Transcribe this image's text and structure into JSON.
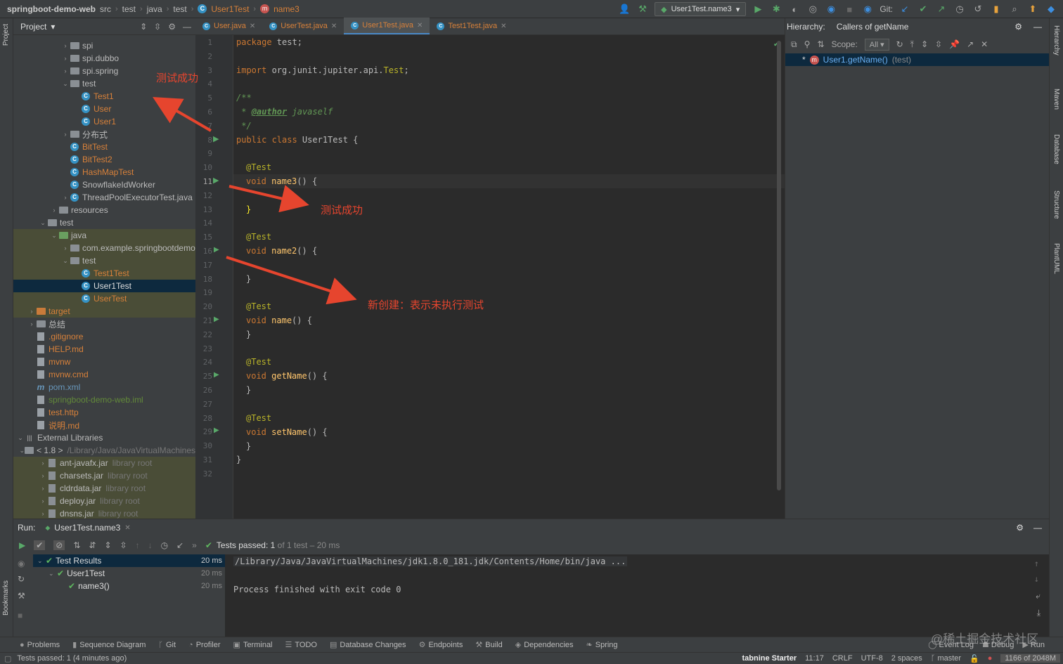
{
  "navbar": {
    "project": "springboot-demo-web",
    "crumbs": [
      "src",
      "test",
      "java",
      "test"
    ],
    "file": "User1Test",
    "method": "name3",
    "run_config": "User1Test.name3",
    "git_label": "Git:"
  },
  "project_panel": {
    "title": "Project",
    "items": [
      {
        "label": "spi",
        "indent": 4,
        "kind": "folder",
        "arrow": "›"
      },
      {
        "label": "spi.dubbo",
        "indent": 4,
        "kind": "folder",
        "arrow": "›"
      },
      {
        "label": "spi.spring",
        "indent": 4,
        "kind": "folder",
        "arrow": "›"
      },
      {
        "label": "test",
        "indent": 4,
        "kind": "folder",
        "arrow": "⌄"
      },
      {
        "label": "Test1",
        "indent": 5,
        "kind": "class",
        "color": "orange"
      },
      {
        "label": "User",
        "indent": 5,
        "kind": "class",
        "color": "orange"
      },
      {
        "label": "User1",
        "indent": 5,
        "kind": "class",
        "color": "orange"
      },
      {
        "label": "分布式",
        "indent": 4,
        "kind": "folder",
        "arrow": "›"
      },
      {
        "label": "BitTest",
        "indent": 4,
        "kind": "class",
        "color": "orange"
      },
      {
        "label": "BitTest2",
        "indent": 4,
        "kind": "class",
        "color": "orange"
      },
      {
        "label": "HashMapTest",
        "indent": 4,
        "kind": "class",
        "color": "orange"
      },
      {
        "label": "SnowflakeIdWorker",
        "indent": 4,
        "kind": "class",
        "color": "plain"
      },
      {
        "label": "ThreadPoolExecutorTest.java",
        "indent": 4,
        "kind": "class",
        "color": "plain",
        "arrow": "›"
      },
      {
        "label": "resources",
        "indent": 3,
        "kind": "folder",
        "arrow": "›"
      },
      {
        "label": "test",
        "indent": 2,
        "kind": "folder",
        "arrow": "⌄"
      },
      {
        "label": "java",
        "indent": 3,
        "kind": "folder-green",
        "arrow": "⌄",
        "hl": "olive"
      },
      {
        "label": "com.example.springbootdemo",
        "indent": 4,
        "kind": "folder",
        "arrow": "›",
        "hl": "olive"
      },
      {
        "label": "test",
        "indent": 4,
        "kind": "folder",
        "arrow": "⌄",
        "hl": "olive"
      },
      {
        "label": "Test1Test",
        "indent": 5,
        "kind": "class",
        "color": "orange",
        "hl": "olive"
      },
      {
        "label": "User1Test",
        "indent": 5,
        "kind": "class",
        "color": "plain",
        "hl": "sel"
      },
      {
        "label": "UserTest",
        "indent": 5,
        "kind": "class",
        "color": "orange",
        "hl": "olive"
      },
      {
        "label": "target",
        "indent": 1,
        "kind": "folder-orange",
        "arrow": "›",
        "color": "orange",
        "hl": "olive"
      },
      {
        "label": "总结",
        "indent": 1,
        "kind": "folder",
        "arrow": "›"
      },
      {
        "label": ".gitignore",
        "indent": 1,
        "kind": "file",
        "color": "orange"
      },
      {
        "label": "HELP.md",
        "indent": 1,
        "kind": "file",
        "color": "orange"
      },
      {
        "label": "mvnw",
        "indent": 1,
        "kind": "file",
        "color": "orange"
      },
      {
        "label": "mvnw.cmd",
        "indent": 1,
        "kind": "file",
        "color": "orange"
      },
      {
        "label": "pom.xml",
        "indent": 1,
        "kind": "maven",
        "color": "blue"
      },
      {
        "label": "springboot-demo-web.iml",
        "indent": 1,
        "kind": "file",
        "color": "green"
      },
      {
        "label": "test.http",
        "indent": 1,
        "kind": "file",
        "color": "orange"
      },
      {
        "label": "说明.md",
        "indent": 1,
        "kind": "file",
        "color": "orange"
      },
      {
        "label": "External Libraries",
        "indent": 0,
        "kind": "lib",
        "arrow": "⌄"
      },
      {
        "label": "< 1.8 >",
        "indent": 1,
        "kind": "folder",
        "arrow": "⌄",
        "suffix": "/Library/Java/JavaVirtualMachines"
      },
      {
        "label": "ant-javafx.jar",
        "indent": 2,
        "kind": "jar",
        "arrow": "›",
        "suffix": "library root",
        "hl": "olive"
      },
      {
        "label": "charsets.jar",
        "indent": 2,
        "kind": "jar",
        "arrow": "›",
        "suffix": "library root",
        "hl": "olive"
      },
      {
        "label": "cldrdata.jar",
        "indent": 2,
        "kind": "jar",
        "arrow": "›",
        "suffix": "library root",
        "hl": "olive"
      },
      {
        "label": "deploy.jar",
        "indent": 2,
        "kind": "jar",
        "arrow": "›",
        "suffix": "library root",
        "hl": "olive"
      },
      {
        "label": "dnsns.jar",
        "indent": 2,
        "kind": "jar",
        "arrow": "›",
        "suffix": "library root",
        "hl": "olive"
      }
    ]
  },
  "editor": {
    "tabs": [
      {
        "label": "User.java",
        "active": false
      },
      {
        "label": "UserTest.java",
        "active": false
      },
      {
        "label": "User1Test.java",
        "active": true
      },
      {
        "label": "Test1Test.java",
        "active": false
      }
    ],
    "line_numbers": [
      "1",
      "2",
      "3",
      "4",
      "5",
      "6",
      "7",
      "8",
      "9",
      "10",
      "11",
      "12",
      "13",
      "14",
      "15",
      "16",
      "17",
      "18",
      "19",
      "20",
      "21",
      "22",
      "23",
      "24",
      "25",
      "26",
      "27",
      "28",
      "29",
      "30",
      "31",
      "32"
    ],
    "code": {
      "l1_kw": "package",
      "l1_rest": " test;",
      "l3_kw": "import",
      "l3_rest": " org.junit.jupiter.api.",
      "l3_cls": "Test",
      "l3_end": ";",
      "l5": "/**",
      "l6_a": " * ",
      "l6_tag": "@author",
      "l6_b": " javaself",
      "l7": " */",
      "l8_kw": "public class",
      "l8_rest": " User1Test {",
      "test_ann": "@Test",
      "void_kw": "void",
      "m_name3": "name3",
      "m_name2": "name2",
      "m_name": "name",
      "m_getName": "getName",
      "m_setName": "setName",
      "sig_end": "() {",
      "close": "}"
    }
  },
  "hierarchy": {
    "title": "Hierarchy:",
    "mode": "Callers of getName",
    "scope_label": "Scope:",
    "scope_value": "All",
    "entry": "User1.getName()",
    "entry_pkg": "(test)"
  },
  "right_stripe": [
    "Hierarchy",
    "Maven",
    "Database",
    "Structure",
    "PlantUML"
  ],
  "left_stripe": [
    "Project",
    "Bookmarks"
  ],
  "run_panel": {
    "label": "Run:",
    "tab": "User1Test.name3",
    "status": "Tests passed:",
    "status_count": "1",
    "status_of": "of 1 test – 20 ms",
    "tree": [
      {
        "label": "Test Results",
        "time": "20 ms",
        "indent": 0
      },
      {
        "label": "User1Test",
        "time": "20 ms",
        "indent": 1
      },
      {
        "label": "name3()",
        "time": "20 ms",
        "indent": 2
      }
    ],
    "console_line1": "/Library/Java/JavaVirtualMachines/jdk1.8.0_181.jdk/Contents/Home/bin/java ...",
    "console_line2": "Process finished with exit code 0"
  },
  "bottom_tools": [
    "Problems",
    "Sequence Diagram",
    "Git",
    "Profiler",
    "Terminal",
    "TODO",
    "Database Changes",
    "Endpoints",
    "Build",
    "Dependencies",
    "Spring"
  ],
  "bottom_right_tools": [
    "Event Log",
    "Debug",
    "Run"
  ],
  "statusbar": {
    "message": "Tests passed: 1 (4 minutes ago)",
    "tabnine": "tabnine Starter",
    "position": "11:17",
    "line_sep": "CRLF",
    "encoding": "UTF-8",
    "indent": "2 spaces",
    "branch": "master",
    "memory": "1166 of 2048M"
  },
  "annotations": {
    "note_tree": "测试成功",
    "note_code": "测试成功",
    "note_new": "新创建：表示未执行测试",
    "watermark": "@稀土掘金技术社区"
  },
  "colors": {
    "accent": "#4a88c7",
    "arrow": "#e6452e",
    "pass": "#5fb85f"
  }
}
